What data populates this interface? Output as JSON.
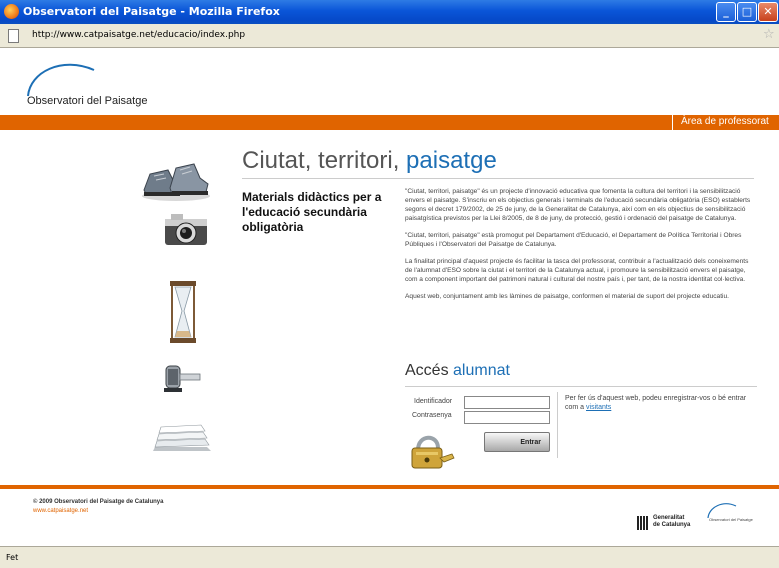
{
  "window": {
    "title": "Observatori del Paisatge - Mozilla Firefox",
    "minimize": "_",
    "maximize": "□",
    "close": "✕"
  },
  "address_bar": {
    "url": "http://www.catpaisatge.net/educacio/index.php"
  },
  "header": {
    "logo_text": "Observatori del Paisatge",
    "area_link": "Àrea de professorat"
  },
  "main": {
    "title_part1": "Ciutat, territori,",
    "title_part2": "paisatge",
    "subtitle": "Materials didàctics per a l'educació secundària obligatòria",
    "paragraphs": [
      "\"Ciutat, territori, paisatge\" és un projecte d'innovació educativa que fomenta la cultura del territori i la sensibilització envers el paisatge. S'inscriu en els objectius generals i terminals de l'educació secundària obligatòria (ESO) establerts segons el decret 179/2002, de 25 de juny, de la Generalitat de Catalunya, així com en els objectius de sensibilització paisatgística previstos per la Llei 8/2005, de 8 de juny, de protecció, gestió i ordenació del paisatge de Catalunya.",
      "\"Ciutat, territori, paisatge\" està promogut pel Departament d'Educació, el Departament de Política Territorial i Obres Públiques i l'Observatori del Paisatge de Catalunya.",
      "La finalitat principal d'aquest projecte és facilitar la tasca del professorat, contribuir a l'actualització dels coneixements de l'alumnat d'ESO sobre la ciutat i el territori de la Catalunya actual, i promoure la sensibilització envers el paisatge, com a component important del patrimoni natural i cultural del nostre país i, per tant, de la nostra identitat col·lectiva.",
      "Aquest web, conjuntament amb les làmines de paisatge, conformen el material de suport del projecte educatiu."
    ]
  },
  "access": {
    "title_part1": "Accés",
    "title_part2": "alumnat",
    "user_label": "Identificador",
    "pass_label": "Contrasenya",
    "user_value": "",
    "pass_value": "",
    "submit_label": "Entrar",
    "register_text": "Per fer ús d'aquest web, podeu enregistrar-vos o bé entrar com a",
    "visitor_link": "visitants"
  },
  "footer": {
    "copyright": "© 2009 Observatori del Paisatge de Catalunya",
    "url": "www.catpaisatge.net",
    "gencat_line1": "Generalitat",
    "gencat_line2": "de Catalunya",
    "partner_logo_text": "Observatori del Paisatge"
  },
  "status_bar": {
    "text": "Fet"
  },
  "colors": {
    "accent_orange": "#e06400",
    "accent_blue": "#1d6fb5",
    "titlebar_blue": "#0a55d8"
  },
  "icons": [
    "firefox-icon",
    "page-icon",
    "bookmark-star-icon",
    "shoes-illustration",
    "camera-illustration",
    "hourglass-illustration",
    "microphone-illustration",
    "papers-illustration",
    "padlock-illustration"
  ]
}
